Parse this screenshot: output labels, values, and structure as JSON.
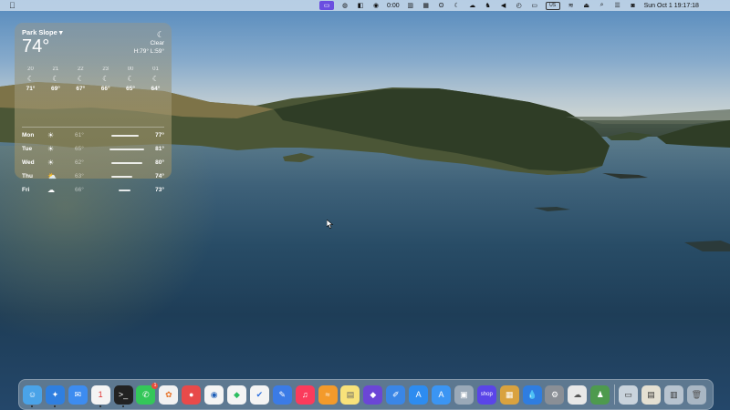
{
  "menubar": {
    "apple_icon": "apple-logo",
    "status_items": [
      {
        "name": "screen-record-icon",
        "glyph": "▭",
        "active": true
      },
      {
        "name": "vpn-icon",
        "glyph": "◍"
      },
      {
        "name": "app-status-icon",
        "glyph": "◧"
      },
      {
        "name": "activity-icon",
        "glyph": "◉"
      },
      {
        "name": "timer-display",
        "text": "0:00"
      },
      {
        "name": "column-icon",
        "glyph": "▥"
      },
      {
        "name": "bars-icon",
        "glyph": "▦"
      },
      {
        "name": "bluetooth-like-icon",
        "glyph": "ʘ"
      },
      {
        "name": "moon-icon",
        "glyph": "☾"
      },
      {
        "name": "cloud-icon",
        "glyph": "☁"
      },
      {
        "name": "elephant-icon",
        "glyph": "♞"
      },
      {
        "name": "volume-icon",
        "glyph": "◀"
      },
      {
        "name": "clock-icon",
        "glyph": "◴"
      },
      {
        "name": "battery-icon",
        "glyph": "▭"
      },
      {
        "name": "input-source-badge",
        "text": "US",
        "boxed": true
      },
      {
        "name": "wifi-icon",
        "glyph": "≋"
      },
      {
        "name": "airplay-icon",
        "glyph": "⏏"
      },
      {
        "name": "search-icon",
        "glyph": "⌕"
      },
      {
        "name": "control-center-icon",
        "glyph": "☰"
      },
      {
        "name": "user-icon",
        "glyph": "◙"
      }
    ],
    "date_time": "Sun Oct 1  19:17:18"
  },
  "weather": {
    "location": "Park Slope",
    "location_arrow": "▾",
    "temperature": "74°",
    "condition_icon": "moon-icon",
    "condition": "Clear",
    "high_low": "H:79° L:59°",
    "hourly": [
      {
        "time": "20",
        "icon": "☾",
        "temp": "71°"
      },
      {
        "time": "21",
        "icon": "☾",
        "temp": "69°"
      },
      {
        "time": "22",
        "icon": "☾",
        "temp": "67°"
      },
      {
        "time": "23",
        "icon": "☾",
        "temp": "66°"
      },
      {
        "time": "00",
        "icon": "☾",
        "temp": "65°"
      },
      {
        "time": "01",
        "icon": "☾",
        "temp": "64°"
      }
    ],
    "daily": [
      {
        "day": "Mon",
        "icon": "☀",
        "low": "61°",
        "high": "77°",
        "bar_start": 0.05,
        "bar_end": 0.85
      },
      {
        "day": "Tue",
        "icon": "☀",
        "low": "65°",
        "high": "81°",
        "bar_start": 0.0,
        "bar_end": 1.0
      },
      {
        "day": "Wed",
        "icon": "☀",
        "low": "62°",
        "high": "80°",
        "bar_start": 0.05,
        "bar_end": 0.95
      },
      {
        "day": "Thu",
        "icon": "⛅",
        "low": "63°",
        "high": "74°",
        "bar_start": 0.05,
        "bar_end": 0.65
      },
      {
        "day": "Fri",
        "icon": "☁",
        "low": "66°",
        "high": "73°",
        "bar_start": 0.25,
        "bar_end": 0.6
      }
    ]
  },
  "dock": {
    "apps": [
      {
        "name": "finder-icon",
        "glyph": "☺",
        "color": "#4aa3e8",
        "running": true
      },
      {
        "name": "safari-icon",
        "glyph": "✦",
        "color": "#2f7fe0",
        "running": true
      },
      {
        "name": "mail-icon",
        "glyph": "✉",
        "color": "#3d8cf0"
      },
      {
        "name": "calendar-icon",
        "glyph": "1",
        "color": "#f4f4f4",
        "text_color": "#e03030",
        "running": true
      },
      {
        "name": "terminal-icon",
        "glyph": ">_",
        "color": "#222222",
        "running": true
      },
      {
        "name": "messages-icon",
        "glyph": "✆",
        "color": "#34c759",
        "badge": "1"
      },
      {
        "name": "photos-icon",
        "glyph": "✿",
        "color": "#f2f2f2",
        "text_color": "#e8742a"
      },
      {
        "name": "record-icon",
        "glyph": "●",
        "color": "#e84a4a"
      },
      {
        "name": "password-manager-icon",
        "glyph": "◉",
        "color": "#f4f4f4",
        "text_color": "#1e5fb8"
      },
      {
        "name": "evernote-icon",
        "glyph": "◆",
        "color": "#f4f4f4",
        "text_color": "#2dbe60"
      },
      {
        "name": "things-icon",
        "glyph": "✔",
        "color": "#f4f4f4",
        "text_color": "#2a6fe0"
      },
      {
        "name": "tot-icon",
        "glyph": "✎",
        "color": "#3b7be6"
      },
      {
        "name": "music-icon",
        "glyph": "♫",
        "color": "#fb3b5c"
      },
      {
        "name": "reeder-icon",
        "glyph": "≈",
        "color": "#f39a2b"
      },
      {
        "name": "notes-icon",
        "glyph": "▤",
        "color": "#f8e27a",
        "text_color": "#666666"
      },
      {
        "name": "obsidian-icon",
        "glyph": "◆",
        "color": "#6b46d6"
      },
      {
        "name": "pencil-app-icon",
        "glyph": "✐",
        "color": "#3a86e6"
      },
      {
        "name": "app-store-icon",
        "glyph": "A",
        "color": "#2d8cf0"
      },
      {
        "name": "app-store-beta-icon",
        "glyph": "A",
        "color": "#3b95f3"
      },
      {
        "name": "preview-icon",
        "glyph": "▣",
        "color": "#9aa9b8"
      },
      {
        "name": "shop-icon",
        "glyph": "shop",
        "color": "#5a45e8"
      },
      {
        "name": "archive-icon",
        "glyph": "▦",
        "color": "#d9a23f"
      },
      {
        "name": "drop-icon",
        "glyph": "💧",
        "color": "#2f7de0"
      },
      {
        "name": "system-settings-icon",
        "glyph": "⚙",
        "color": "#8a8f96"
      },
      {
        "name": "cloud-app-icon",
        "glyph": "☁",
        "color": "#e8e8e8",
        "text_color": "#555555"
      },
      {
        "name": "chess-icon",
        "glyph": "♟",
        "color": "#4e9a4e"
      }
    ],
    "recent": [
      {
        "name": "recent-window-1",
        "glyph": "▭",
        "color": "#c9d3dc",
        "text_color": "#333333"
      },
      {
        "name": "recent-window-2",
        "glyph": "▤",
        "color": "#e4e0d2",
        "text_color": "#333333"
      },
      {
        "name": "recent-window-3",
        "glyph": "▥",
        "color": "#b7c3cf",
        "text_color": "#333333"
      }
    ],
    "trash": {
      "name": "trash-icon",
      "glyph": "🗑",
      "color": "rgba(220,225,230,0.6)",
      "text_color": "#555555"
    }
  }
}
